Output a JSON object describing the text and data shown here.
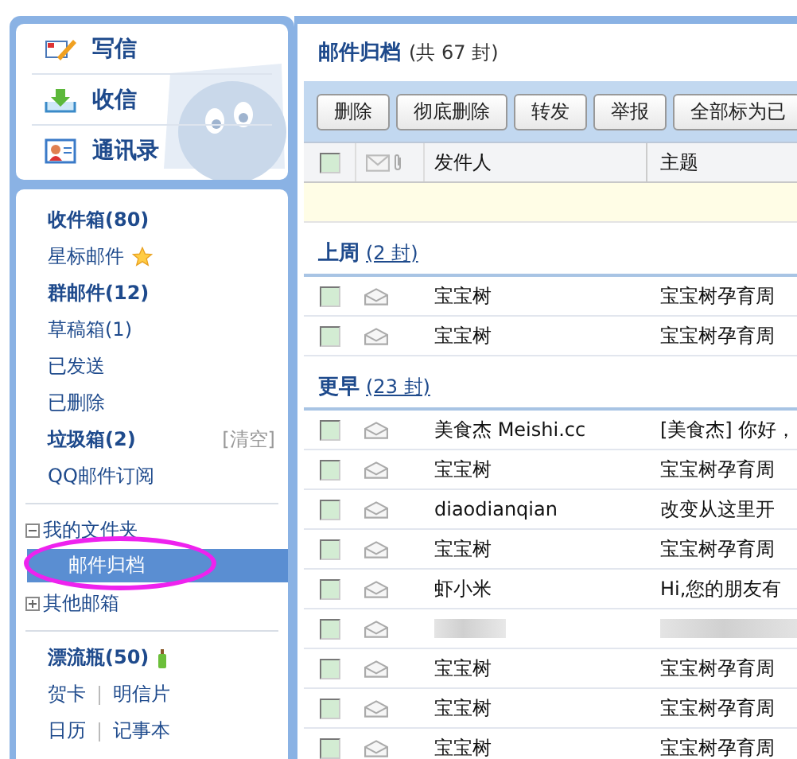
{
  "sidebar": {
    "actions": [
      {
        "kind": "compose",
        "label": "写信"
      },
      {
        "kind": "inbox",
        "label": "收信"
      },
      {
        "kind": "contacts",
        "label": "通讯录"
      }
    ],
    "mail_folders": [
      {
        "kind": "plain",
        "label": "收件箱(80)",
        "bold": true
      },
      {
        "kind": "starred",
        "label": "星标邮件",
        "bold": false
      },
      {
        "kind": "plain",
        "label": "群邮件(12)",
        "bold": true
      },
      {
        "kind": "plain",
        "label": "草稿箱(1)",
        "bold": false
      },
      {
        "kind": "plain",
        "label": "已发送",
        "bold": false
      },
      {
        "kind": "plain",
        "label": "已删除",
        "bold": false
      },
      {
        "kind": "clearable",
        "label": "垃圾箱(2)",
        "bold": true,
        "action": "[清空]"
      },
      {
        "kind": "plain",
        "label": "QQ邮件订阅",
        "bold": false
      }
    ],
    "my_folders": {
      "label": "我的文件夹",
      "expanded": true,
      "children": [
        {
          "label": "邮件归档",
          "selected": true
        }
      ]
    },
    "other_mailboxes": {
      "label": "其他邮箱",
      "expanded": false
    },
    "apps": [
      {
        "kind": "bottle",
        "label": "漂流瓶(50)",
        "bold": true
      }
    ],
    "app_links": [
      {
        "links": [
          "贺卡",
          "明信片"
        ]
      },
      {
        "links": [
          "日历",
          "记事本"
        ]
      }
    ]
  },
  "annotation": {
    "kind": "ellipse"
  },
  "main": {
    "title": "邮件归档",
    "count": "(共 67 封)",
    "toolbar": [
      "删除",
      "彻底删除",
      "转发",
      "举报",
      "全部标为已"
    ],
    "header": {
      "select_all_checked": false,
      "columns": [
        "发件人",
        "主题"
      ]
    },
    "groups": [
      {
        "label": "上周",
        "count": "(2 封)",
        "rows": [
          {
            "kind": "mail",
            "checked": false,
            "sender": "宝宝树",
            "subject": "宝宝树孕育周"
          },
          {
            "kind": "mail",
            "checked": false,
            "sender": "宝宝树",
            "subject": "宝宝树孕育周"
          }
        ]
      },
      {
        "label": "更早",
        "count": "(23 封)",
        "rows": [
          {
            "kind": "mail",
            "checked": false,
            "sender": "美食杰 Meishi.cc",
            "subject": "[美食杰] 你好，"
          },
          {
            "kind": "mail",
            "checked": false,
            "sender": "宝宝树",
            "subject": "宝宝树孕育周"
          },
          {
            "kind": "mail",
            "checked": false,
            "sender": "diaodianqian",
            "subject": "改变从这里开"
          },
          {
            "kind": "mail",
            "checked": false,
            "sender": "宝宝树",
            "subject": "宝宝树孕育周"
          },
          {
            "kind": "mail",
            "checked": false,
            "sender": "虾小米",
            "subject": "Hi,您的朋友有"
          },
          {
            "kind": "blurred",
            "checked": false
          },
          {
            "kind": "mail",
            "checked": false,
            "sender": "宝宝树",
            "subject": "宝宝树孕育周"
          },
          {
            "kind": "mail",
            "checked": false,
            "sender": "宝宝树",
            "subject": "宝宝树孕育周"
          },
          {
            "kind": "mail",
            "checked": false,
            "sender": "宝宝树",
            "subject": "宝宝树孕育周"
          }
        ]
      }
    ]
  }
}
